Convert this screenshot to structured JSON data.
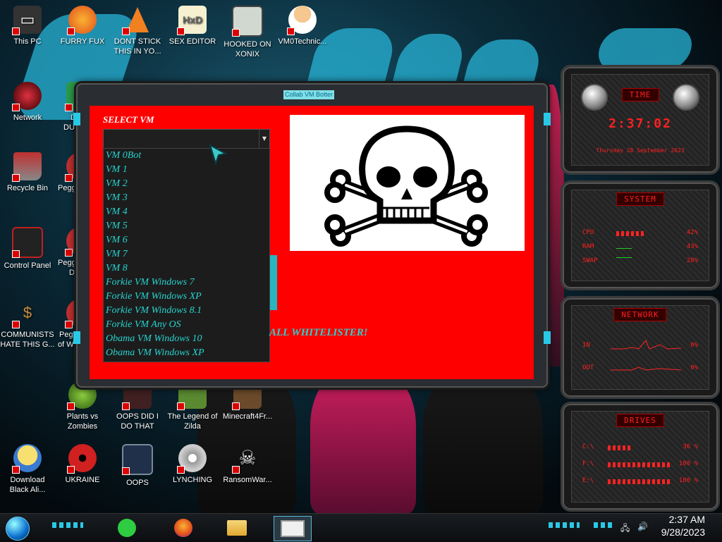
{
  "desktop_icons": [
    {
      "label": "This PC",
      "icon": "computer-icon",
      "color": "#333333"
    },
    {
      "label": "FURRY FUX",
      "icon": "firefox-icon",
      "color": "#e66a1a"
    },
    {
      "label": "DONT STICK THIS IN YO...",
      "icon": "traffic-cone-icon",
      "color": "#f08020"
    },
    {
      "label": "SEX EDITOR",
      "icon": "hxd-icon",
      "color": "#d9c060"
    },
    {
      "label": "HOOKED ON XONIX",
      "icon": "xonix-icon",
      "color": "#6a8a6a"
    },
    {
      "label": "VM0Technic...",
      "icon": "doctor-icon",
      "color": "#f0c080"
    },
    {
      "label": "Network",
      "icon": "network-icon",
      "color": "#b02030"
    },
    {
      "label": "Recycle Bin",
      "icon": "recycle-bin-icon",
      "color": "#c03030"
    },
    {
      "label": "Control Panel",
      "icon": "control-panel-icon",
      "color": "#c02020"
    },
    {
      "label": "COMMUNISTS HATE THIS G...",
      "icon": "money-bag-icon",
      "color": "#c89040"
    },
    {
      "label": "Plants vs Zombies",
      "icon": "plants-icon",
      "color": "#5a8a30"
    },
    {
      "label": "OOPS DID I DO THAT",
      "icon": "oops-icon",
      "color": "#a03030"
    },
    {
      "label": "The Legend of Zilda",
      "icon": "zelda-icon",
      "color": "#7a5030"
    },
    {
      "label": "Minecraft4Fr...",
      "icon": "minecraft-icon",
      "color": "#6a4a2a"
    },
    {
      "label": "Download Black Ali...",
      "icon": "star-butterfly-icon",
      "color": "#f0d060"
    },
    {
      "label": "UKRAINE",
      "icon": "radiation-icon",
      "color": "#d02020"
    },
    {
      "label": "OOPS",
      "icon": "monitor-icon",
      "color": "#20304a"
    },
    {
      "label": "LYNCHING",
      "icon": "gear-flag-icon",
      "color": "#c0c0c0"
    },
    {
      "label": "RansomWar...",
      "icon": "skull-icon",
      "color": "#dddddd"
    }
  ],
  "partial_icons": [
    {
      "label": "D",
      "label2": "DU",
      "icon": "document-icon"
    },
    {
      "label": "Peggl",
      "icon": "peggle-icon"
    },
    {
      "label": "Peggl",
      "label2": "De",
      "icon": "peggle-icon"
    },
    {
      "label": "Peg",
      "label2": "of W",
      "icon": "peggle-icon"
    }
  ],
  "app_window": {
    "title": "Collab VM Botter",
    "select_label": "SELECT VM",
    "selected_value": "",
    "options": [
      "VM 0Bot",
      "VM 1",
      "VM 2",
      "VM 3",
      "VM 4",
      "VM 5",
      "VM 6",
      "VM 7",
      "VM 8",
      "Forkie VM Windows 7",
      "Forkie VM Windows XP",
      "Forkie VM Windows 8.1",
      "Forkie VM Any OS",
      "Obama VM Windows 10",
      "Obama VM Windows XP"
    ],
    "whitelister_text": "ALL WHITELISTER!",
    "image_icon": "skull-crossbones-icon"
  },
  "gadgets": {
    "time": {
      "title": "TIME",
      "clock": "2:37:02",
      "date": "Thursday 28 September 2023"
    },
    "system": {
      "title": "SYSTEM",
      "rows": [
        {
          "label": "CPU",
          "value": "42%",
          "level": 0.42
        },
        {
          "label": "RAM",
          "value": "43%",
          "level": 0.43
        },
        {
          "label": "SWAP",
          "value": "28%",
          "level": 0.28
        }
      ]
    },
    "network": {
      "title": "NETWORK",
      "rows": [
        {
          "label": "IN",
          "value": "0%"
        },
        {
          "label": "OUT",
          "value": "0%"
        }
      ]
    },
    "drives": {
      "title": "DRIVES",
      "rows": [
        {
          "label": "C:\\",
          "value": "36 %",
          "level": 0.36
        },
        {
          "label": "F:\\",
          "value": "100 %",
          "level": 1.0
        },
        {
          "label": "E:\\",
          "value": "100 %",
          "level": 1.0
        }
      ]
    }
  },
  "taskbar": {
    "apps": [
      {
        "name": "notes-app",
        "icon": "note-icon"
      },
      {
        "name": "firefox",
        "icon": "firefox-icon"
      },
      {
        "name": "file-explorer",
        "icon": "folder-icon"
      },
      {
        "name": "collab-vm-botter",
        "icon": "monitor-icon",
        "active": true
      }
    ],
    "clock_time": "2:37 AM",
    "clock_date": "9/28/2023"
  }
}
